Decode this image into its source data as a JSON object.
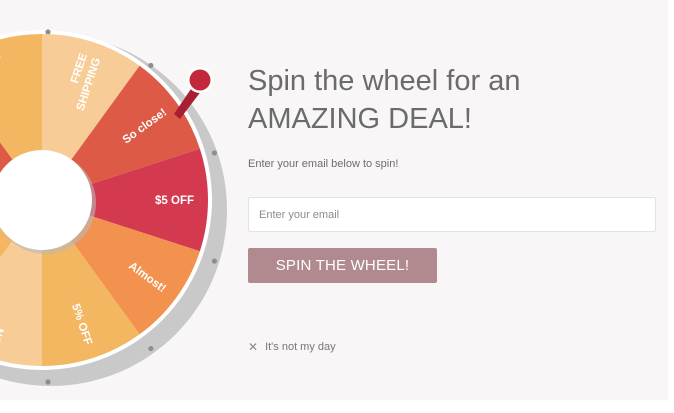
{
  "headline": {
    "line1": "Spin the wheel for an",
    "line2": "AMAZING DEAL!"
  },
  "subtext": "Enter your email below to spin!",
  "email": {
    "placeholder": "Enter your email",
    "value": ""
  },
  "spin_button_label": "SPIN THE WHEEL!",
  "dismiss": {
    "icon": "close-icon",
    "label": "It's not my day"
  },
  "wheel": {
    "segments": [
      {
        "label": "FREE",
        "label2": "SHIPPING",
        "color": "#f8cc96"
      },
      {
        "label": "So close!",
        "label2": "",
        "color": "#dd5a47"
      },
      {
        "label": "$5 OFF",
        "label2": "",
        "color": "#d43a4f"
      },
      {
        "label": "Almost!",
        "label2": "",
        "color": "#f2924e"
      },
      {
        "label": "5% OFF",
        "label2": "",
        "color": "#f3b661"
      },
      {
        "label": "NO",
        "label2": "",
        "color": "#f8cc96"
      },
      {
        "label": "",
        "label2": "",
        "color": "#f3b661"
      },
      {
        "label": "",
        "label2": "",
        "color": "#f2924e"
      },
      {
        "label": "",
        "label2": "",
        "color": "#dd5a47"
      },
      {
        "label": "$",
        "label2": "",
        "color": "#f3b661"
      }
    ],
    "pointer_color": "#c4283d"
  }
}
